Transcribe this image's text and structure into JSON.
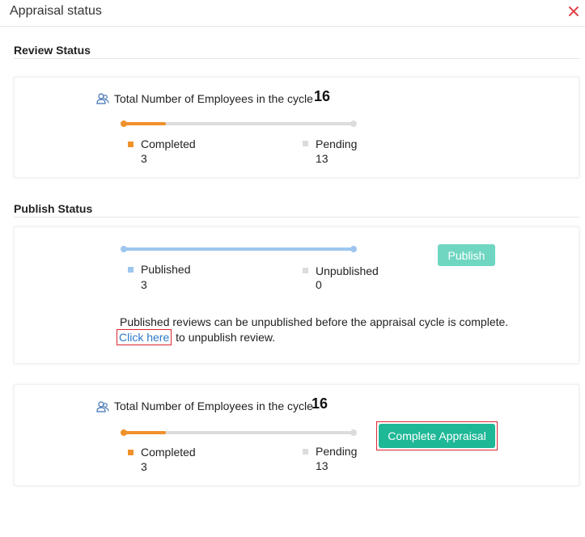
{
  "header": {
    "title": "Appraisal status",
    "close_icon": "close-icon"
  },
  "colors": {
    "completed": "#f0912c",
    "pending": "#dcdcdc",
    "published": "#9dc6ee",
    "publish_button": "#6fd6c2",
    "complete_button": "#1fb897",
    "close": "#e0444b"
  },
  "review_status": {
    "title": "Review Status",
    "total_label": "Total Number of Employees in the cycle",
    "total_value": "16",
    "progress_fraction": 0.1875,
    "completed": {
      "label": "Completed",
      "value": "3"
    },
    "pending": {
      "label": "Pending",
      "value": "13"
    }
  },
  "publish_status": {
    "title": "Publish Status",
    "progress_fraction": 1.0,
    "published": {
      "label": "Published",
      "value": "3"
    },
    "unpublished": {
      "label": "Unpublished",
      "value": "0"
    },
    "publish_button": "Publish",
    "note": "Published reviews can be unpublished before the appraisal cycle is complete.",
    "link_text": "Click here",
    "link_suffix": "to unpublish review."
  },
  "complete_section": {
    "total_label": "Total Number of Employees in the cycle",
    "total_value": "16",
    "progress_fraction": 0.1875,
    "completed": {
      "label": "Completed",
      "value": "3"
    },
    "pending": {
      "label": "Pending",
      "value": "13"
    },
    "button": "Complete Appraisal"
  }
}
